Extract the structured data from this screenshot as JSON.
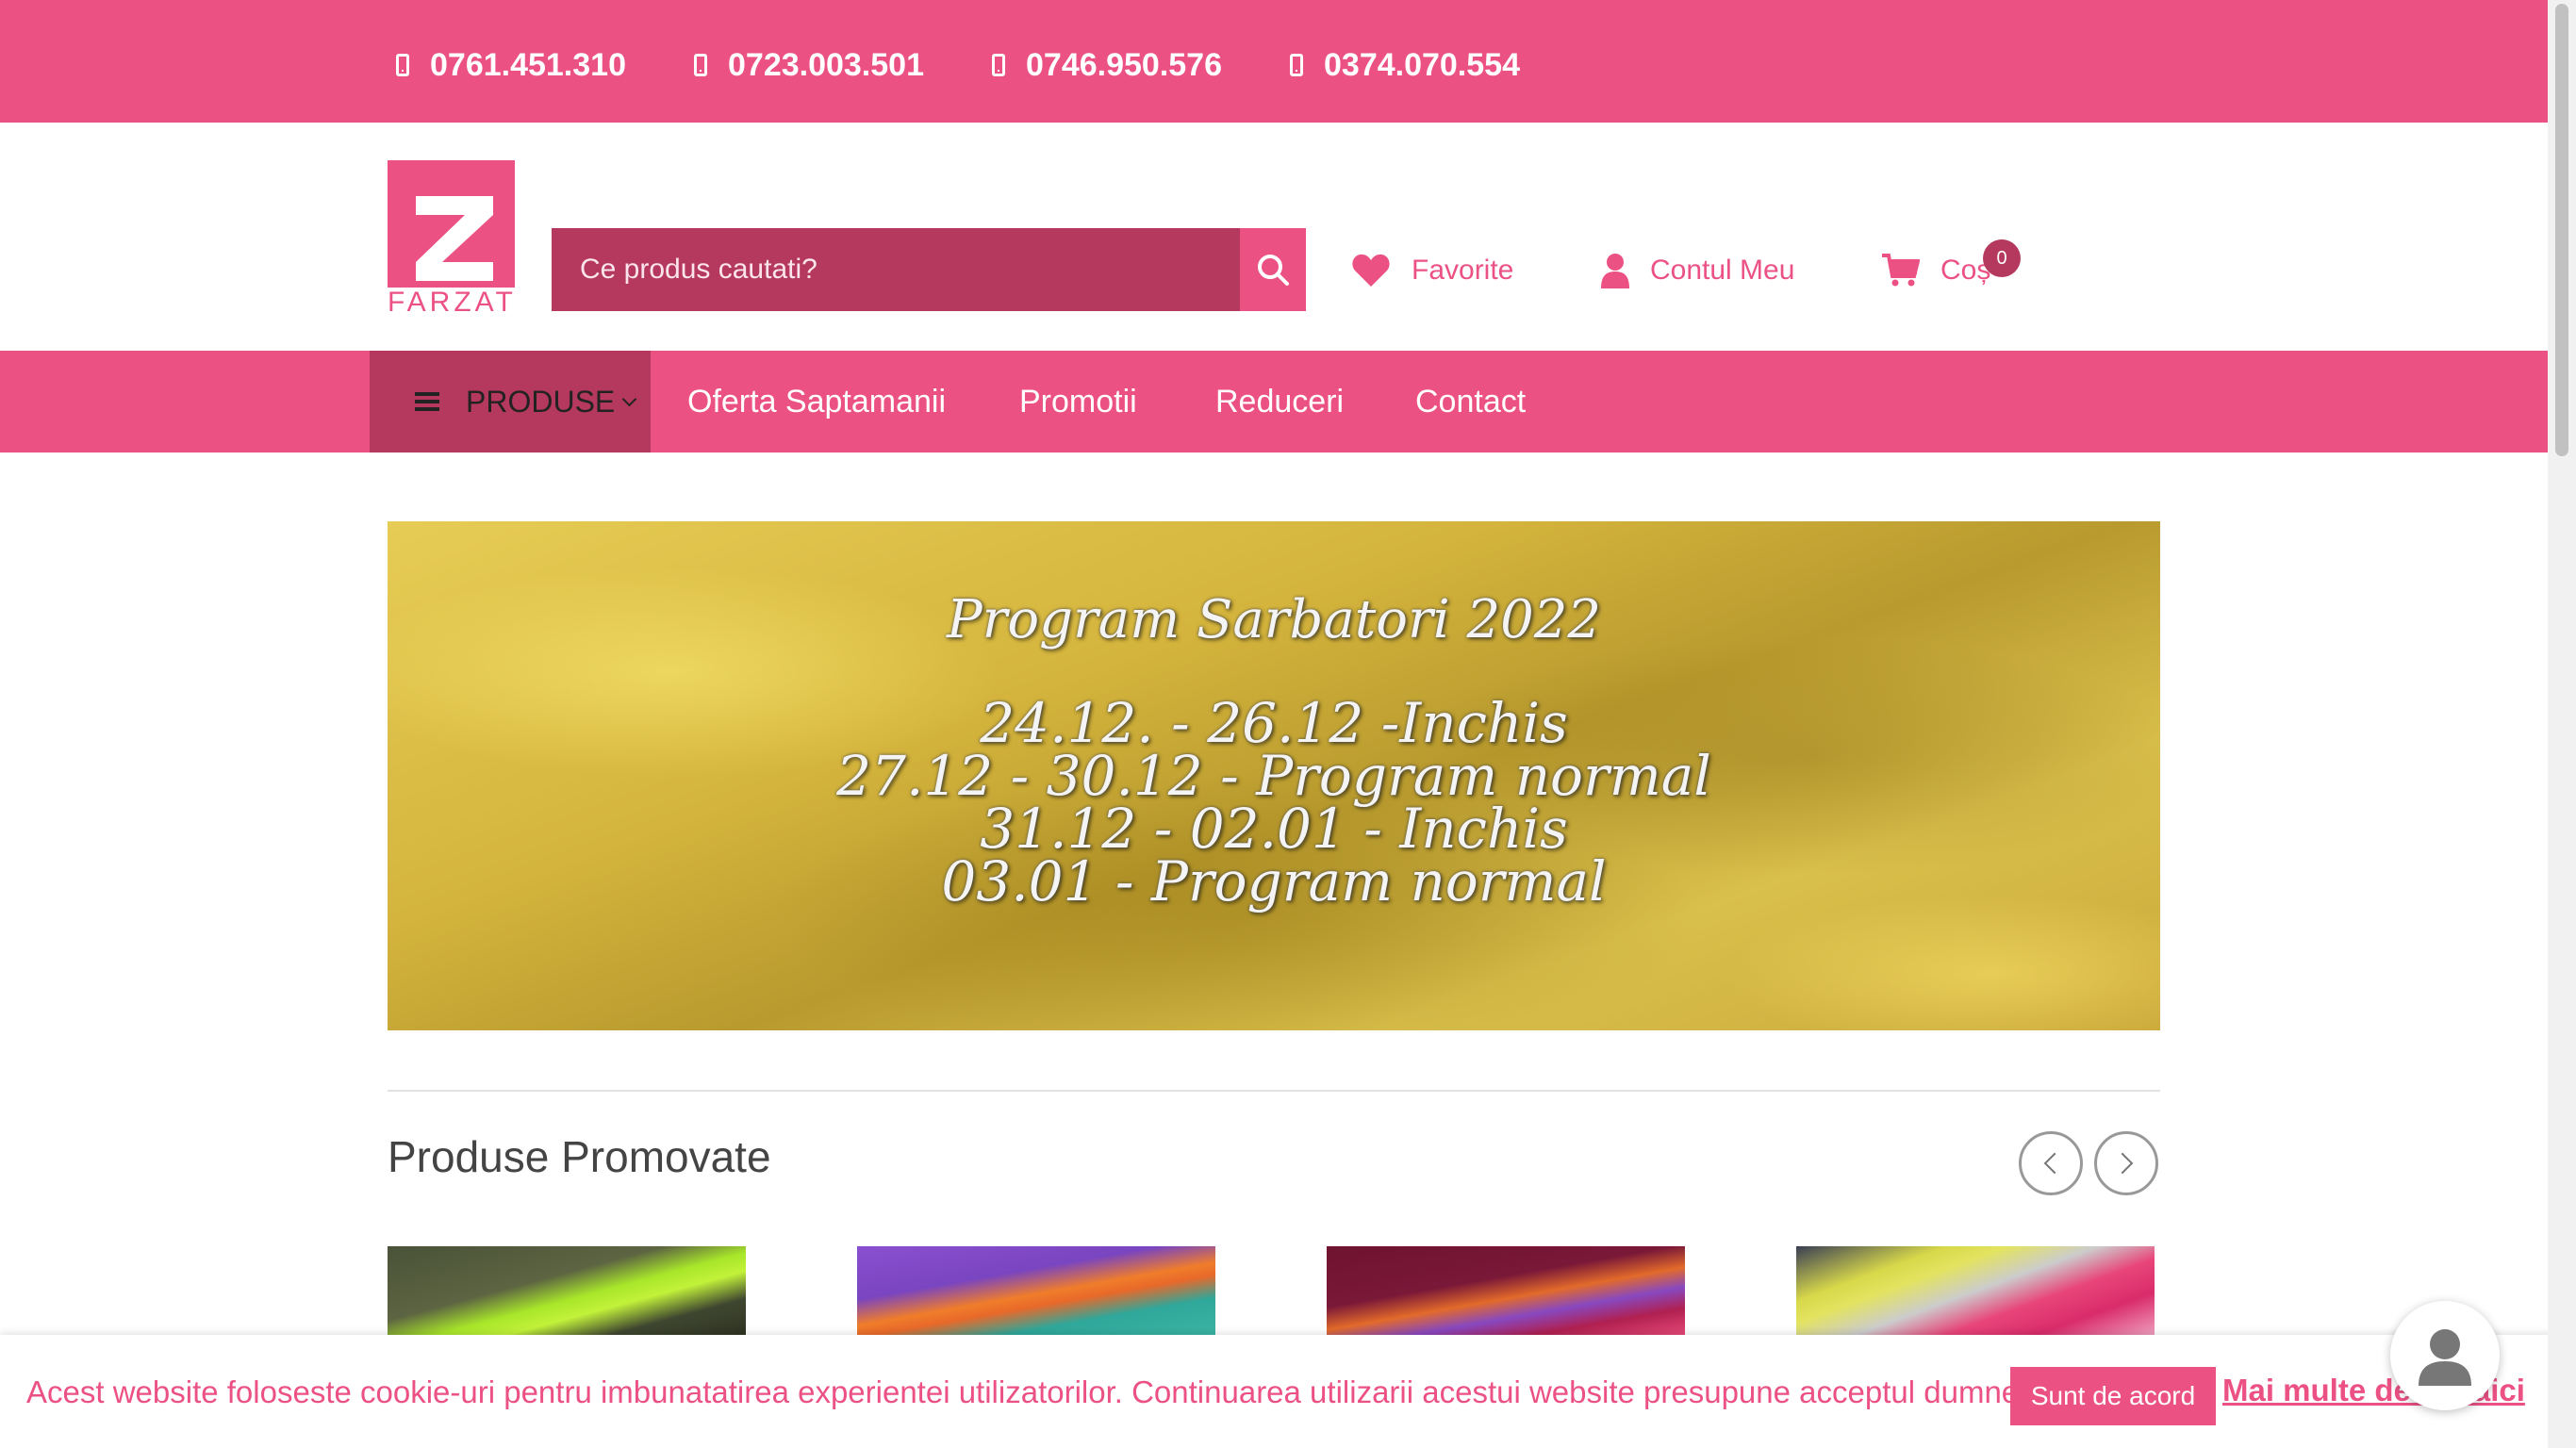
{
  "topbar": {
    "phones": [
      "0761.451.310",
      "0723.003.501",
      "0746.950.576",
      "0374.070.554"
    ]
  },
  "header": {
    "logo_text": "FARZAT",
    "search_placeholder": "Ce produs cautati?",
    "favorites_label": "Favorite",
    "account_label": "Contul Meu",
    "cart_label": "Coș",
    "cart_count": "0"
  },
  "nav": {
    "products_label": "PRODUSE",
    "links": [
      "Oferta Saptamanii",
      "Promotii",
      "Reduceri",
      "Contact"
    ]
  },
  "banner": {
    "title": "Program Sarbatori 2022",
    "lines": [
      "24.12. - 26.12 -Inchis",
      "27.12 - 30.12 - Program normal",
      "31.12 - 02.01 - Inchis",
      "03.01 - Program normal"
    ]
  },
  "section": {
    "title": "Produse Promovate"
  },
  "cookie": {
    "message": "Acest website foloseste cookie-uri pentru imbunatatirea experientei utilizatorilor. Continuarea utilizarii acestui website presupune acceptul dumneavoastra.",
    "accept_label": "Sunt de acord",
    "more_label": "Mai multe detalii aici"
  },
  "colors": {
    "brand_pink": "#ec5184",
    "dark_pink": "#b5395f"
  },
  "icons": [
    "phone-icon",
    "search-icon",
    "heart-icon",
    "user-icon",
    "cart-icon",
    "hamburger-icon",
    "chevron-down-icon",
    "chevron-left-icon",
    "chevron-right-icon",
    "chat-avatar-icon"
  ]
}
